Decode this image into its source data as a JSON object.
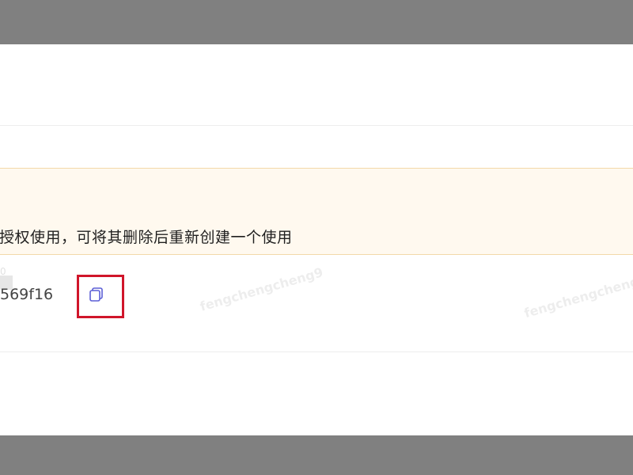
{
  "notice": {
    "text": "授权使用，可将其删除后重新创建一个使用"
  },
  "key": {
    "value_fragment": "569f16"
  },
  "copy_button": {
    "icon": "copy-icon",
    "accent_color": "#5b5fd6",
    "highlight_color": "#d0152a"
  },
  "watermark": {
    "text": "fengchengcheng9",
    "text2": "fengchengcheng",
    "fragment": "0"
  }
}
